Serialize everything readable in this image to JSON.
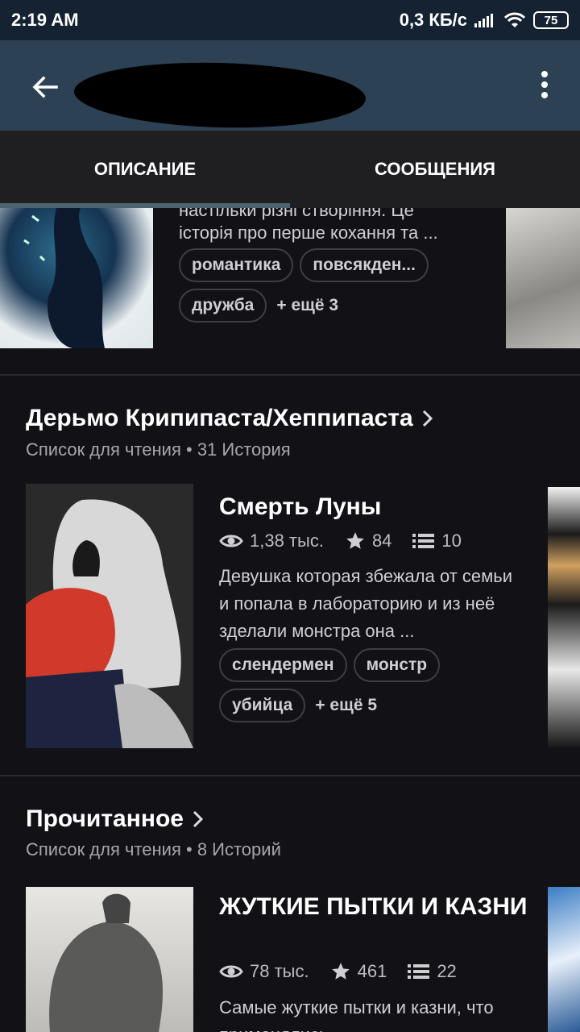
{
  "status_bar": {
    "time": "2:19 AM",
    "network_speed": "0,3 КБ/с",
    "battery": "75",
    "icons": [
      "signal-icon",
      "wifi-icon",
      "battery-icon"
    ]
  },
  "app_bar": {
    "back_icon": "arrow-left-icon",
    "title": "",
    "menu_icon": "more-vert-icon"
  },
  "tabs": [
    {
      "label": "ОПИСАНИЕ",
      "selected": true
    },
    {
      "label": "СООБЩЕНИЯ",
      "selected": false
    }
  ],
  "top_story": {
    "desc_fragment": "настільки різні створіння. Це",
    "desc": "історія про перше кохання та ...",
    "tags": [
      "романтика",
      "повсякден..."
    ],
    "tags2": [
      "дружба"
    ],
    "more": "+ ещё 3"
  },
  "lists": [
    {
      "title": "Дерьмо Крипипаста/Хеппипаста",
      "subtitle": "Список для чтения • 31 История",
      "story": {
        "title": "Смерть Луны",
        "views": "1,38 тыс.",
        "votes": "84",
        "parts": "10",
        "desc": "Девушка которая збежала от семьи и попала в лабораторию и из неё зделали монстра она ...",
        "tags": [
          "слендермен",
          "монстр"
        ],
        "tags2": [
          "убийца"
        ],
        "more": "+ ещё 5"
      }
    },
    {
      "title": "Прочитанное",
      "subtitle": "Список для чтения • 8 Историй",
      "story": {
        "title": "ЖУТКИЕ ПЫТКИ И КАЗНИ",
        "views": "78 тыс.",
        "votes": "461",
        "parts": "22",
        "desc": "Самые жуткие пытки и казни, что применялись"
      }
    }
  ],
  "colors": {
    "status_bar_bg": "#152231",
    "app_bar_bg": "#2d4154",
    "tabs_bg": "#1f1e21",
    "page_bg": "#121115",
    "tab_indicator": "#4d6372"
  }
}
